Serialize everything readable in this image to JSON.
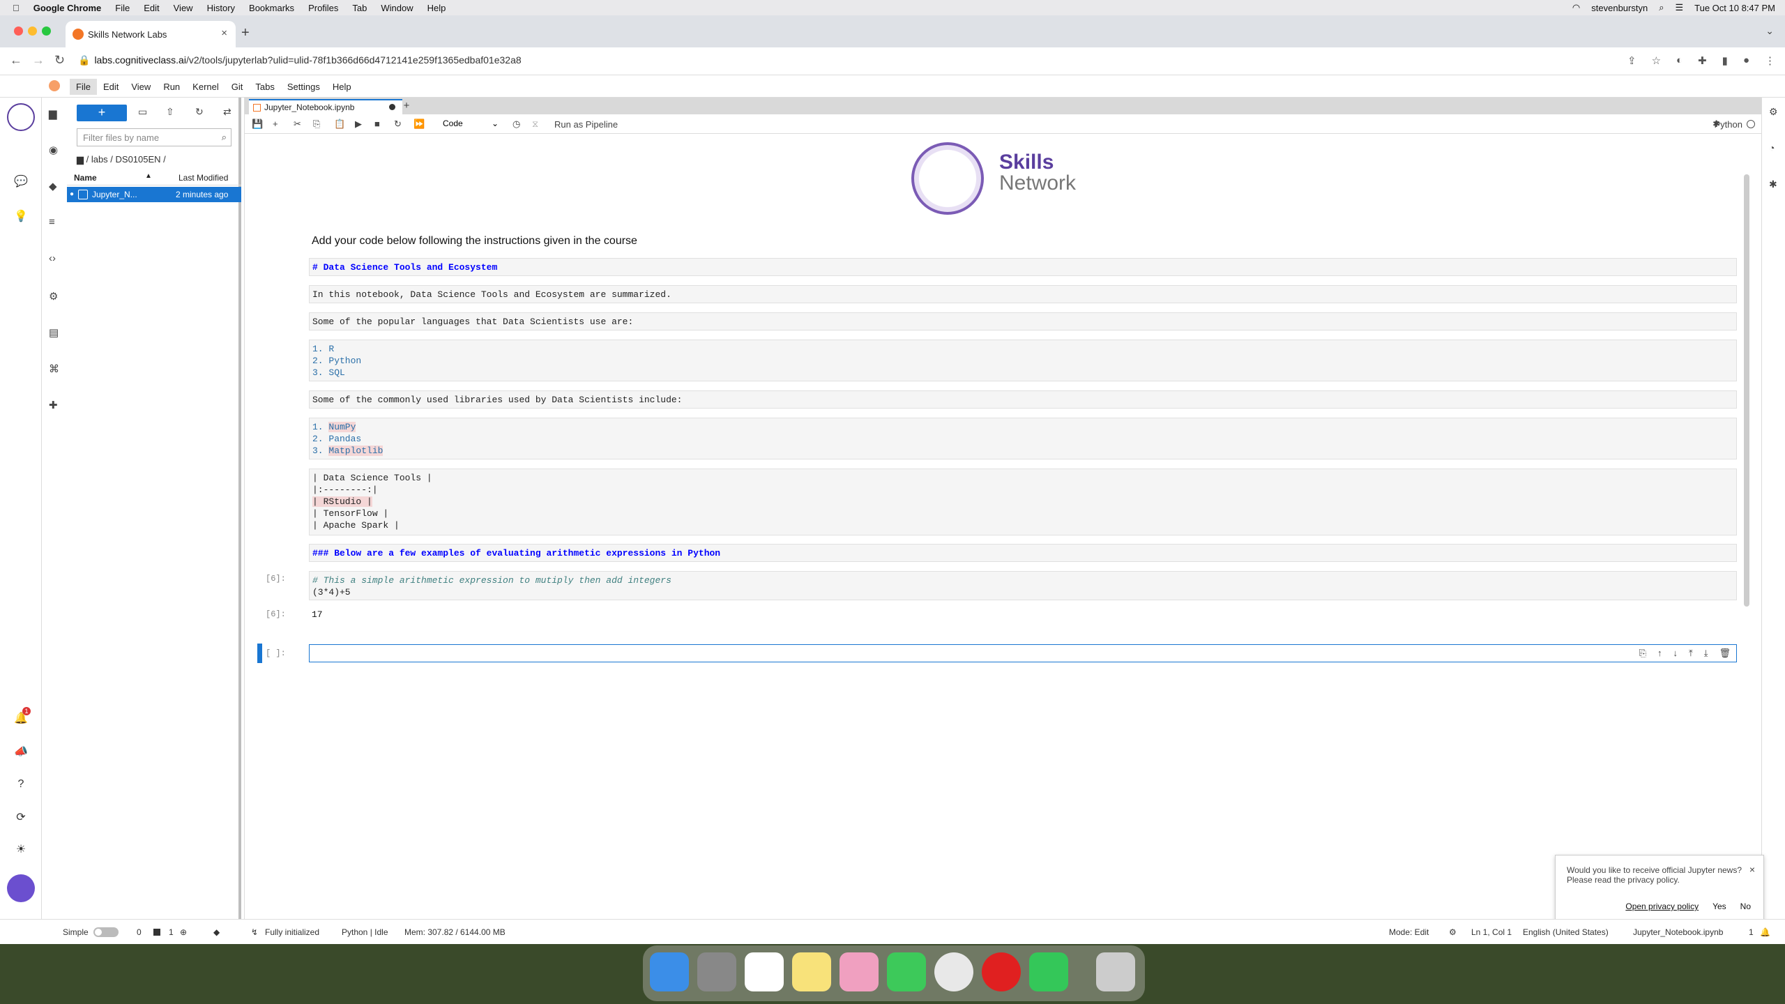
{
  "macos": {
    "apple": "",
    "app": "Google Chrome",
    "menus": [
      "File",
      "Edit",
      "View",
      "History",
      "Bookmarks",
      "Profiles",
      "Tab",
      "Window",
      "Help"
    ],
    "user": "stevenburstyn",
    "datetime": "Tue Oct 10  8:47 PM"
  },
  "chrome": {
    "tab_title": "Skills Network Labs",
    "url_host": "labs.cognitiveclass.ai",
    "url_path": "/v2/tools/jupyterlab?ulid=ulid-78f1b366d66d4712141e259f1365edbaf01e32a8"
  },
  "jupyter": {
    "menus": [
      "File",
      "Edit",
      "View",
      "Run",
      "Kernel",
      "Git",
      "Tabs",
      "Settings",
      "Help"
    ],
    "filebrowser": {
      "new_label": "+",
      "filter_placeholder": "Filter files by name",
      "breadcrumb": "/ labs / DS0105EN /",
      "col_name": "Name",
      "col_modified": "Last Modified",
      "files": [
        {
          "name": "Jupyter_N...",
          "modified": "2 minutes ago"
        }
      ]
    },
    "notebook_tab": "Jupyter_Notebook.ipynb",
    "cell_type": "Code",
    "run_pipeline": "Run as Pipeline",
    "kernel": "Python",
    "logo_line1": "Skills",
    "logo_line2": "Network",
    "intro": "Add your code below following the instructions given in the course",
    "cells": {
      "h1": "# Data Science Tools and Ecosystem",
      "intro_md": "In this notebook, Data Science Tools and Ecosystem are summarized.",
      "langs_intro": "Some of the popular languages that Data Scientists use are:",
      "langs": [
        "R",
        "Python",
        "SQL"
      ],
      "libs_intro": "Some of the commonly used libraries used by Data Scientists include:",
      "libs": [
        "NumPy",
        "Pandas",
        "Matplotlib"
      ],
      "table_lines": [
        "| Data Science Tools |",
        "|:--------:|",
        "|  RStudio |",
        "|  TensorFlow  |",
        "|  Apache Spark   |"
      ],
      "h3": "### Below are a few examples of evaluating arithmetic expressions in Python",
      "code_prompt": "[6]:",
      "code_comment": "# This a simple arithmetic expression to mutiply then add integers",
      "code_line": "(3*4)+5",
      "out_prompt": "[6]:",
      "out_value": "17",
      "empty_prompt": "[ ]:"
    },
    "notification": {
      "line1": "Would you like to receive official Jupyter news?",
      "line2": "Please read the privacy policy.",
      "policy": "Open privacy policy",
      "yes": "Yes",
      "no": "No"
    },
    "status": {
      "mode_label": "Simple",
      "count0": "0",
      "count1": "1",
      "init": "Fully initialized",
      "kernel": "Python | Idle",
      "mem": "Mem: 307.82 / 6144.00 MB",
      "edit_mode": "Mode: Edit",
      "pos": "Ln 1, Col 1",
      "lang": "English (United States)",
      "file": "Jupyter_Notebook.ipynb",
      "num": "1"
    },
    "notification_badge": "1"
  },
  "colors": {
    "accent": "#1976d2",
    "orange": "#f37626",
    "purple": "#5a3e9e"
  }
}
